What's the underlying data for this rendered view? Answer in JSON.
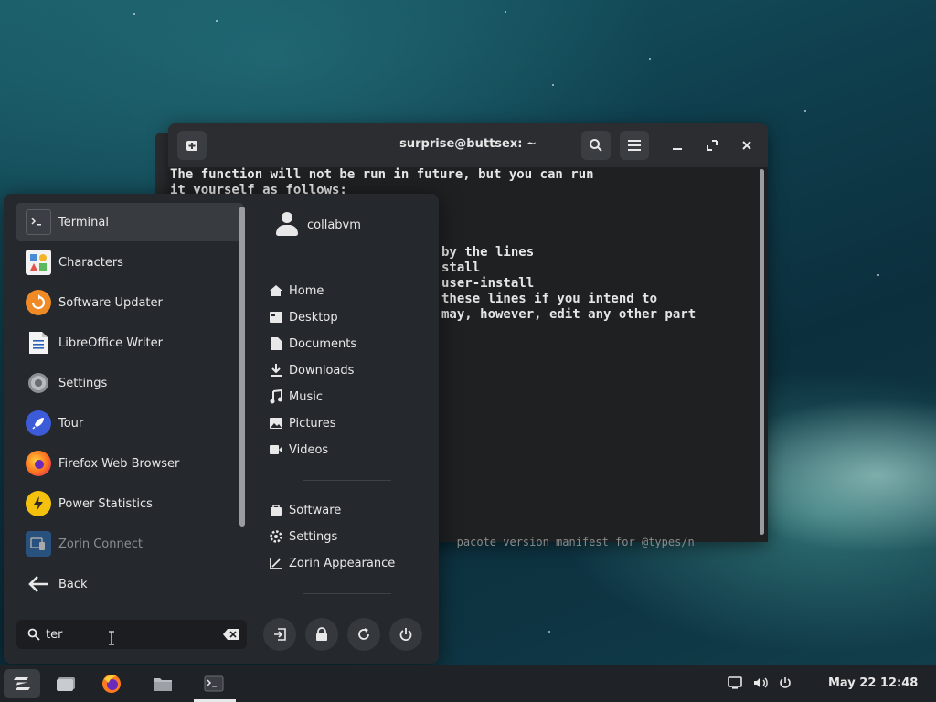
{
  "terminal": {
    "title": "surprise@buttsex: ~",
    "lines": [
      "The function will not be run in future, but you can run",
      "it yourself as follows:",
      "by the lines",
      "stall",
      "user-install",
      "these lines if you intend to",
      "may, however, edit any other part"
    ],
    "bottom_line": "   pacote version manifest for @types/n"
  },
  "menu": {
    "apps": [
      {
        "label": "Terminal",
        "icon": "terminal-icon"
      },
      {
        "label": "Characters",
        "icon": "characters-icon"
      },
      {
        "label": "Software Updater",
        "icon": "software-updater-icon"
      },
      {
        "label": "LibreOffice Writer",
        "icon": "libreoffice-writer-icon"
      },
      {
        "label": "Settings",
        "icon": "settings-gear-icon"
      },
      {
        "label": "Tour",
        "icon": "rocket-icon"
      },
      {
        "label": "Firefox Web Browser",
        "icon": "firefox-icon"
      },
      {
        "label": "Power Statistics",
        "icon": "power-statistics-icon"
      },
      {
        "label": "Zorin Connect",
        "icon": "zorin-connect-icon"
      },
      {
        "label": "Back",
        "icon": "back-arrow-icon"
      }
    ],
    "user": "collabvm",
    "places": [
      {
        "label": "Home",
        "icon": "home-icon"
      },
      {
        "label": "Desktop",
        "icon": "desktop-folder-icon"
      },
      {
        "label": "Documents",
        "icon": "documents-icon"
      },
      {
        "label": "Downloads",
        "icon": "downloads-icon"
      },
      {
        "label": "Music",
        "icon": "music-icon"
      },
      {
        "label": "Pictures",
        "icon": "pictures-icon"
      },
      {
        "label": "Videos",
        "icon": "videos-icon"
      }
    ],
    "system": [
      {
        "label": "Software",
        "icon": "software-icon"
      },
      {
        "label": "Settings",
        "icon": "settings-icon"
      },
      {
        "label": "Zorin Appearance",
        "icon": "appearance-icon"
      }
    ],
    "search": {
      "value": "ter"
    }
  },
  "taskbar": {
    "clock": "May 22  12:48"
  }
}
